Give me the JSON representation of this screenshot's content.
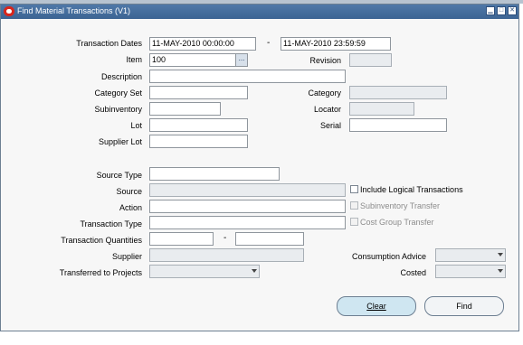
{
  "window": {
    "title": "Find Material Transactions (V1)",
    "minimize": "▁",
    "maximize": "□",
    "close": "✕"
  },
  "form": {
    "transaction_dates": {
      "label": "Transaction Dates",
      "from": "11-MAY-2010 00:00:00",
      "separator": "-",
      "to": "11-MAY-2010 23:59:59"
    },
    "item": {
      "label": "Item",
      "value": "100",
      "lov": "..."
    },
    "revision": {
      "label": "Revision",
      "value": ""
    },
    "description": {
      "label": "Description",
      "value": ""
    },
    "category_set": {
      "label": "Category Set",
      "value": ""
    },
    "category": {
      "label": "Category",
      "value": ""
    },
    "subinventory": {
      "label": "Subinventory",
      "value": ""
    },
    "locator": {
      "label": "Locator",
      "value": ""
    },
    "lot": {
      "label": "Lot",
      "value": ""
    },
    "serial": {
      "label": "Serial",
      "value": ""
    },
    "supplier_lot": {
      "label": "Supplier Lot",
      "value": ""
    },
    "source_type": {
      "label": "Source Type",
      "value": ""
    },
    "source": {
      "label": "Source",
      "value": ""
    },
    "action": {
      "label": "Action",
      "value": ""
    },
    "transaction_type": {
      "label": "Transaction Type",
      "value": ""
    },
    "transaction_quantities": {
      "label": "Transaction Quantities",
      "from": "",
      "separator": "-",
      "to": ""
    },
    "supplier": {
      "label": "Supplier",
      "value": ""
    },
    "transferred_to_projects": {
      "label": "Transferred to Projects",
      "value": ""
    },
    "consumption_advice": {
      "label": "Consumption Advice",
      "value": ""
    },
    "costed": {
      "label": "Costed",
      "value": ""
    }
  },
  "checkboxes": {
    "include_logical": "Include Logical Transactions",
    "subinventory_transfer": "Subinventory Transfer",
    "cost_group_transfer": "Cost Group Transfer"
  },
  "buttons": {
    "clear": "Clear",
    "find": "Find"
  }
}
